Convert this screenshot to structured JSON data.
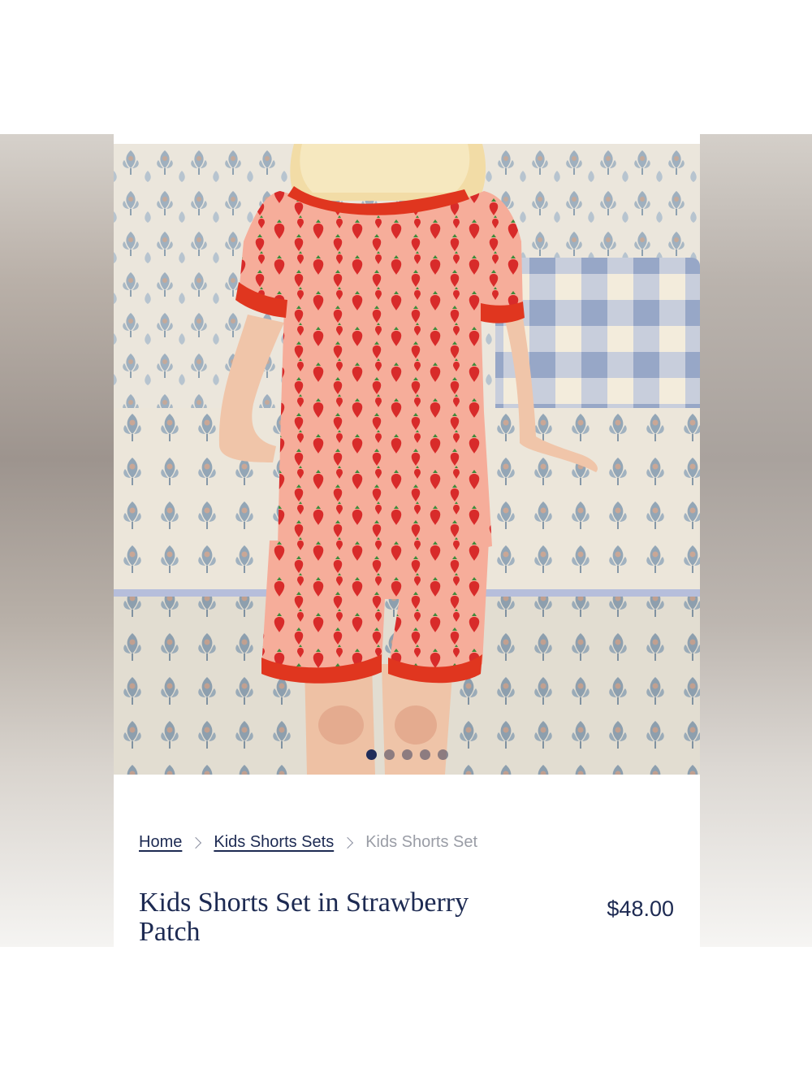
{
  "breadcrumb": {
    "home": "Home",
    "category": "Kids Shorts Sets",
    "current": "Kids Shorts Set"
  },
  "product": {
    "title": "Kids Shorts Set in Strawberry Patch",
    "price": "$48.00",
    "image_alt": "Child wearing strawberry print kids shorts set sitting on patterned bench"
  },
  "carousel": {
    "total_slides": 5,
    "active_index": 0
  },
  "colors": {
    "brand_navy": "#1d2a52",
    "garment_pink": "#f4a996",
    "trim_red": "#e0361f",
    "strawberry": "#d92a2a"
  }
}
